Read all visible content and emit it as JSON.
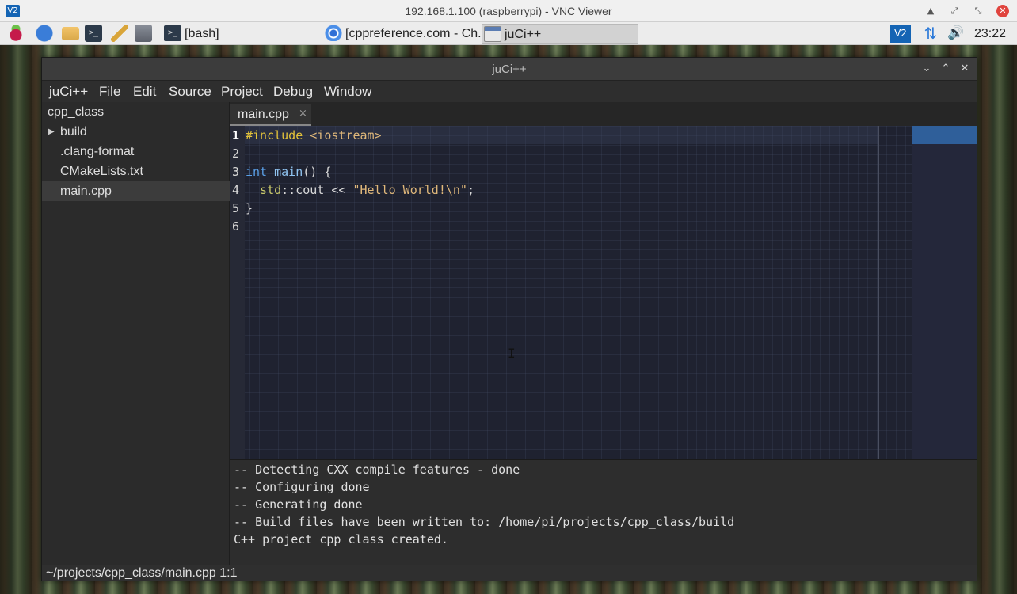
{
  "vnc": {
    "logo": "V2",
    "title": "192.168.1.100 (raspberrypi) - VNC Viewer",
    "controls": {
      "minimize": "▲",
      "restore": "⤢",
      "maximize": "⤡",
      "close": "✕"
    }
  },
  "panel": {
    "launchers": [
      "raspberry-icon",
      "globe-icon",
      "folder-icon",
      "terminal-icon",
      "text-editor-icon",
      "tools-icon"
    ],
    "terminal_glyph": ">_",
    "tasks": [
      {
        "label": "[bash]",
        "icon": "terminal-icon"
      },
      {
        "label": "[cppreference.com - Ch...",
        "icon": "chromium-icon"
      },
      {
        "label": "juCi++",
        "icon": "window-icon",
        "active": true
      }
    ],
    "tray": {
      "vnc_label": "V2",
      "network_glyph": "⇅",
      "volume_glyph": "🔊",
      "clock": "23:22"
    }
  },
  "window": {
    "title": "juCi++",
    "controls": {
      "minimize": "⌄",
      "maximize": "⌃",
      "close": "✕"
    },
    "menu": [
      "juCi++",
      "File",
      "Edit",
      "Source",
      "Project",
      "Debug",
      "Window"
    ]
  },
  "sidebar": {
    "root": "cpp_class",
    "items": [
      {
        "label": "build",
        "type": "folder",
        "expander": "▶"
      },
      {
        "label": ".clang-format",
        "type": "file"
      },
      {
        "label": "CMakeLists.txt",
        "type": "file"
      },
      {
        "label": "main.cpp",
        "type": "file",
        "selected": true
      }
    ]
  },
  "tab": {
    "label": "main.cpp",
    "close_glyph": "×"
  },
  "editor": {
    "line_numbers": [
      "1",
      "2",
      "3",
      "4",
      "5",
      "6"
    ],
    "lines": {
      "l1_pre": "#include",
      "l1_rest": " <iostream>",
      "l3_type": "int",
      "l3_fn": " main",
      "l3_rest": "() {",
      "l4_ns": "  std",
      "l4_mid": "::cout << ",
      "l4_str": "\"Hello World!\\n\"",
      "l4_end": ";",
      "l5": "}"
    },
    "cursor_glyph": "I"
  },
  "terminal": {
    "lines": [
      "-- Detecting CXX compile features - done",
      "-- Configuring done",
      "-- Generating done",
      "-- Build files have been written to: /home/pi/projects/cpp_class/build",
      "C++ project cpp_class created."
    ]
  },
  "status": {
    "text": "~/projects/cpp_class/main.cpp 1:1"
  },
  "colors": {
    "accent": "#2f5f9a",
    "preprocessor": "#e2c23a",
    "keyword": "#5aa0e8",
    "string": "#e0b87a"
  }
}
